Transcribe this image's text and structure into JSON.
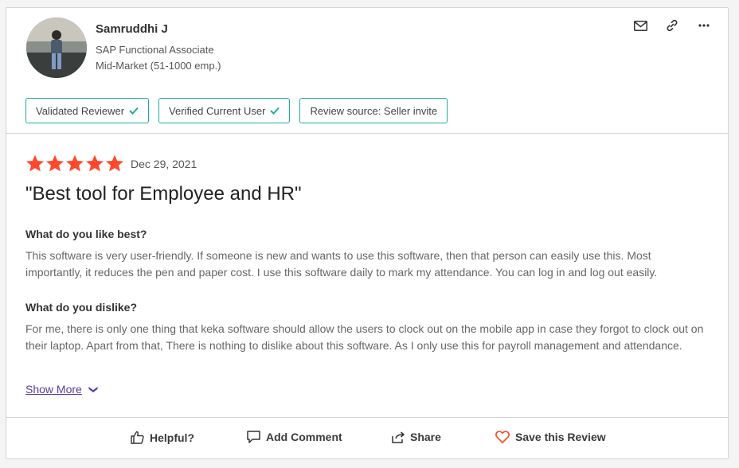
{
  "reviewer": {
    "name": "Samruddhi J",
    "title": "SAP Functional Associate",
    "segment": "Mid-Market (51-1000 emp.)"
  },
  "badges": [
    {
      "label": "Validated Reviewer",
      "icon": "check-icon"
    },
    {
      "label": "Verified Current User",
      "icon": "check-icon"
    },
    {
      "label": "Review source: Seller invite",
      "icon": ""
    }
  ],
  "review": {
    "stars": 5,
    "date": "Dec 29, 2021",
    "title": "\"Best tool for Employee and HR\"",
    "q_like": "What do you like best?",
    "a_like": "This software is very user-friendly. If someone is new and wants to use this software, then that person can easily use this. Most importantly, it reduces the pen and paper cost. I use this software daily to mark my attendance. You can log in and log out easily.",
    "q_dislike": "What do you dislike?",
    "a_dislike": "For me, there is only one thing that keka software should allow the users to clock out on the mobile app in case they forgot to clock out on their laptop. Apart from that, There is nothing to dislike about this software. As I only use this for payroll management and attendance.",
    "show_more": "Show More"
  },
  "footer": {
    "helpful": "Helpful?",
    "add_comment": "Add Comment",
    "share": "Share",
    "save": "Save this Review"
  },
  "colors": {
    "star": "#ff492c",
    "badge_border": "#1fae9a",
    "check": "#1fae9a",
    "link": "#5a39a2",
    "heart": "#ff492c"
  }
}
